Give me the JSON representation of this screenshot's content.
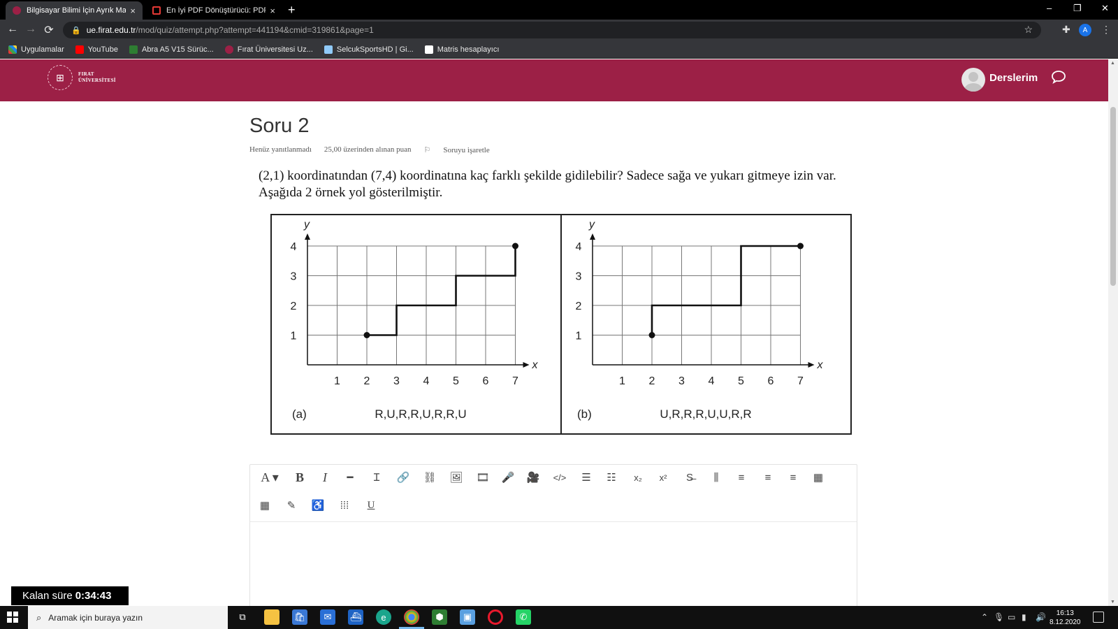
{
  "browser": {
    "tabs": [
      {
        "title": "Bilgisayar Bilimi İçin Ayrık Matem",
        "close": "×"
      },
      {
        "title": "En İyi PDF Dönüştürücü: PDF Dö",
        "close": "×"
      }
    ],
    "new_tab": "+",
    "window": {
      "minimize": "–",
      "restore": "❐",
      "close": "✕"
    },
    "url_host": "ue.firat.edu.tr",
    "url_path": "/mod/quiz/attempt.php?attempt=441194&cmid=319861&page=1",
    "profile_letter": "A",
    "bookmarks": [
      {
        "label": "Uygulamalar",
        "color": "#e8710a"
      },
      {
        "label": "YouTube",
        "color": "#ff0000"
      },
      {
        "label": "Abra A5 V15 Sürüc...",
        "color": "#2e7d32"
      },
      {
        "label": "Fırat Üniversitesi Uz...",
        "color": "#9c2046"
      },
      {
        "label": "SelcukSportsHD | Gi...",
        "color": "#90caf9"
      },
      {
        "label": "Matris hesaplayıcı",
        "color": "#ffffff"
      }
    ]
  },
  "site": {
    "logo_line1": "FIRAT",
    "logo_line2": "ÜNİVERSİTESİ",
    "user_menu": "Derslerim",
    "brand_color": "#9c2046"
  },
  "question": {
    "title": "Soru 2",
    "status": "Henüz yanıtlanmadı",
    "points": "25,00 üzerinden alınan puan",
    "flag": "Soruyu işaretle",
    "text": "(2,1) koordinatından (7,4) koordinatına kaç farklı şekilde gidilebilir? Sadece sağa ve yukarı gitmeye izin var. Aşağıda 2 örnek yol gösterilmiştir."
  },
  "chart_data": [
    {
      "type": "line",
      "panel": "(a)",
      "caption": "R,U,R,R,U,R,R,U",
      "xlabel": "x",
      "ylabel": "y",
      "x_ticks": [
        1,
        2,
        3,
        4,
        5,
        6,
        7
      ],
      "y_ticks": [
        1,
        2,
        3,
        4
      ],
      "xlim": [
        0,
        7
      ],
      "ylim": [
        0,
        4
      ],
      "grid": true,
      "path": [
        [
          2,
          1
        ],
        [
          3,
          1
        ],
        [
          3,
          2
        ],
        [
          4,
          2
        ],
        [
          5,
          2
        ],
        [
          5,
          3
        ],
        [
          6,
          3
        ],
        [
          7,
          3
        ],
        [
          7,
          4
        ]
      ],
      "endpoints": [
        [
          2,
          1
        ],
        [
          7,
          4
        ]
      ]
    },
    {
      "type": "line",
      "panel": "(b)",
      "caption": "U,R,R,R,U,U,R,R",
      "xlabel": "x",
      "ylabel": "y",
      "x_ticks": [
        1,
        2,
        3,
        4,
        5,
        6,
        7
      ],
      "y_ticks": [
        1,
        2,
        3,
        4
      ],
      "xlim": [
        0,
        7
      ],
      "ylim": [
        0,
        4
      ],
      "grid": true,
      "path": [
        [
          2,
          1
        ],
        [
          2,
          2
        ],
        [
          3,
          2
        ],
        [
          4,
          2
        ],
        [
          5,
          2
        ],
        [
          5,
          3
        ],
        [
          5,
          4
        ],
        [
          6,
          4
        ],
        [
          7,
          4
        ]
      ],
      "endpoints": [
        [
          2,
          1
        ],
        [
          7,
          4
        ]
      ]
    }
  ],
  "editor": {
    "row1": [
      {
        "name": "font-style-icon",
        "glyph": "A ▾"
      },
      {
        "name": "bold-icon",
        "glyph": "B"
      },
      {
        "name": "italic-icon",
        "glyph": "I"
      },
      {
        "name": "horizontal-rule-icon",
        "glyph": "━"
      },
      {
        "name": "clear-format-icon",
        "glyph": "Ɪ"
      },
      {
        "name": "link-icon",
        "glyph": "🔗"
      },
      {
        "name": "unlink-icon",
        "glyph": "⛓"
      },
      {
        "name": "image-icon",
        "glyph": "🖼"
      },
      {
        "name": "media-icon",
        "glyph": "🎞"
      },
      {
        "name": "record-audio-icon",
        "glyph": "🎤"
      },
      {
        "name": "record-video-icon",
        "glyph": "🎥"
      },
      {
        "name": "html-code-icon",
        "glyph": "</>"
      },
      {
        "name": "bullet-list-icon",
        "glyph": "☰"
      },
      {
        "name": "numbered-list-icon",
        "glyph": "☷"
      },
      {
        "name": "subscript-icon",
        "glyph": "x₂"
      },
      {
        "name": "superscript-icon",
        "glyph": "x²"
      },
      {
        "name": "strikethrough-icon",
        "glyph": "S̶"
      },
      {
        "name": "rtl-icon",
        "glyph": "⫼"
      },
      {
        "name": "align-left-icon",
        "glyph": "≡"
      },
      {
        "name": "align-center-icon",
        "glyph": "≡"
      },
      {
        "name": "align-right-icon",
        "glyph": "≡"
      },
      {
        "name": "table-icon",
        "glyph": "▦"
      }
    ],
    "row2": [
      {
        "name": "equation-icon",
        "glyph": "▦"
      },
      {
        "name": "edit-icon",
        "glyph": "✎"
      },
      {
        "name": "accessibility-icon",
        "glyph": "♿"
      },
      {
        "name": "special-char-icon",
        "glyph": "⁞⁞⁞"
      },
      {
        "name": "underline-icon",
        "glyph": "U"
      }
    ]
  },
  "timer": {
    "label": "Kalan süre",
    "value": "0:34:43"
  },
  "taskbar": {
    "search_placeholder": "Aramak için buraya yazın",
    "time": "16:13",
    "date": "8.12.2020"
  }
}
